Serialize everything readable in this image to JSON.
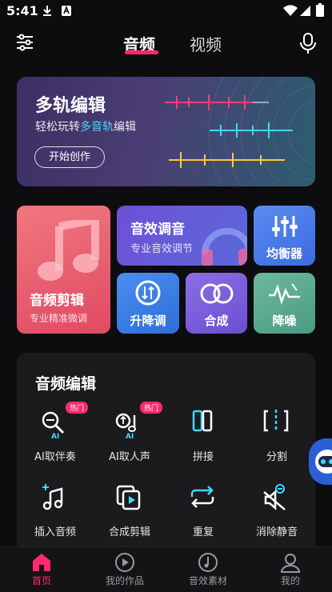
{
  "status_bar": {
    "time": "5:41"
  },
  "top_bar": {
    "tab_audio": "音频",
    "tab_video": "视频"
  },
  "banner": {
    "title": "多轨编辑",
    "subtitle_pre": "轻松玩转",
    "subtitle_highlight": "多音轨",
    "subtitle_post": "编辑",
    "button": "开始创作"
  },
  "cards": {
    "audio_clip": {
      "label": "音频剪辑",
      "sub": "专业精准微调"
    },
    "sound_effect": {
      "label": "音效调音",
      "sub": "专业音效调节"
    },
    "equalizer": {
      "label": "均衡器"
    },
    "pitch": {
      "label": "升降调"
    },
    "merge": {
      "label": "合成"
    },
    "denoise": {
      "label": "降噪"
    }
  },
  "tools_panel": {
    "title": "音频编辑",
    "items": [
      {
        "label": "AI取伴奏",
        "badge": "热门",
        "icon": "ai-mic-icon"
      },
      {
        "label": "AI取人声",
        "badge": "热门",
        "icon": "ai-voice-icon"
      },
      {
        "label": "拼接",
        "icon": "splice-icon"
      },
      {
        "label": "分割",
        "icon": "split-icon"
      },
      {
        "label": "插入音频",
        "icon": "insert-audio-icon"
      },
      {
        "label": "合成剪辑",
        "icon": "merge-clip-icon"
      },
      {
        "label": "重复",
        "icon": "repeat-icon"
      },
      {
        "label": "消除静音",
        "icon": "remove-silence-icon"
      }
    ],
    "ai_tag": "AI"
  },
  "bottom_nav": {
    "items": [
      {
        "label": "首页",
        "active": true
      },
      {
        "label": "我的作品"
      },
      {
        "label": "音效素材"
      },
      {
        "label": "我的"
      }
    ]
  },
  "colors": {
    "accent": "#ff2a6d",
    "cyan": "#4fd1ff",
    "panel": "#1b1b1e"
  }
}
